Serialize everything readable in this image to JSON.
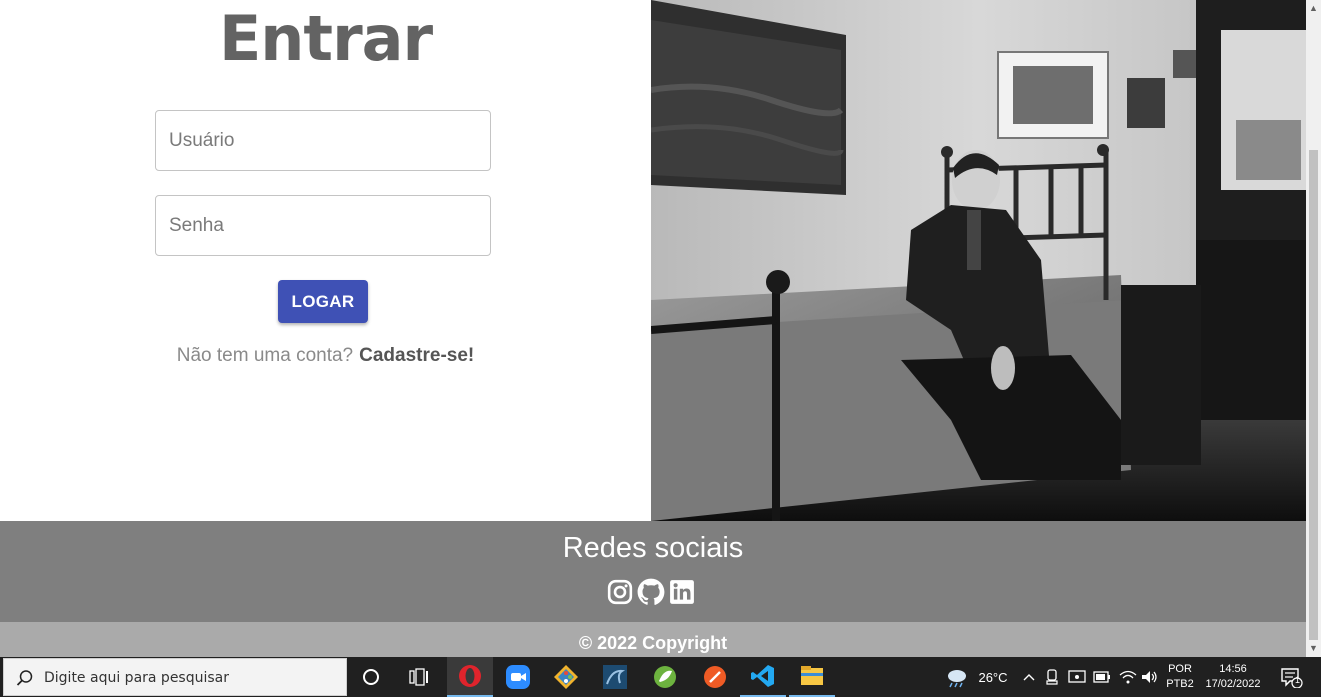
{
  "login": {
    "title": "Entrar",
    "username_placeholder": "Usuário",
    "password_placeholder": "Senha",
    "submit_label": "LOGAR",
    "signup_prompt": "Não tem uma conta?",
    "signup_link": "Cadastre-se!"
  },
  "footer": {
    "social_title": "Redes sociais",
    "social_icons": [
      "instagram-icon",
      "github-icon",
      "linkedin-icon"
    ],
    "copyright": "© 2022 Copyright"
  },
  "colors": {
    "primary_button": "#3f51b5",
    "footer_bg": "#7f7f7f",
    "copyright_bg": "#aaaaaa",
    "title_text": "#636363"
  },
  "taskbar": {
    "search_placeholder": "Digite aqui para pesquisar",
    "apps": [
      "cortana-icon",
      "task-view-icon",
      "opera-icon",
      "zoom-icon",
      "git-icon",
      "mysql-workbench-icon",
      "spring-tools-icon",
      "postman-icon",
      "vscode-icon",
      "file-explorer-icon"
    ],
    "weather_temp": "26°C",
    "language_line1": "POR",
    "language_line2": "PTB2",
    "time": "14:56",
    "date": "17/02/2022",
    "notification_count": "1"
  }
}
